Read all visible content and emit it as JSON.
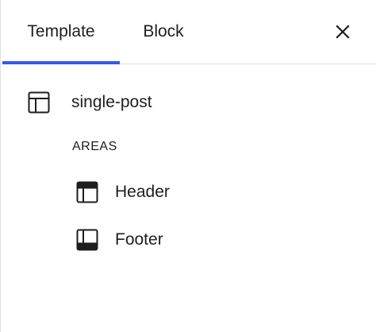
{
  "tabs": [
    {
      "label": "Template",
      "active": true
    },
    {
      "label": "Block",
      "active": false
    }
  ],
  "close": {
    "icon": "close-icon"
  },
  "template": {
    "icon": "layout-icon",
    "name": "single-post"
  },
  "areas": {
    "heading": "AREAS",
    "items": [
      {
        "label": "Header",
        "icon": "header-icon"
      },
      {
        "label": "Footer",
        "icon": "footer-icon"
      }
    ]
  },
  "colors": {
    "accent": "#3858e9",
    "text": "#1e1e1e",
    "border": "#e0e0e0"
  }
}
